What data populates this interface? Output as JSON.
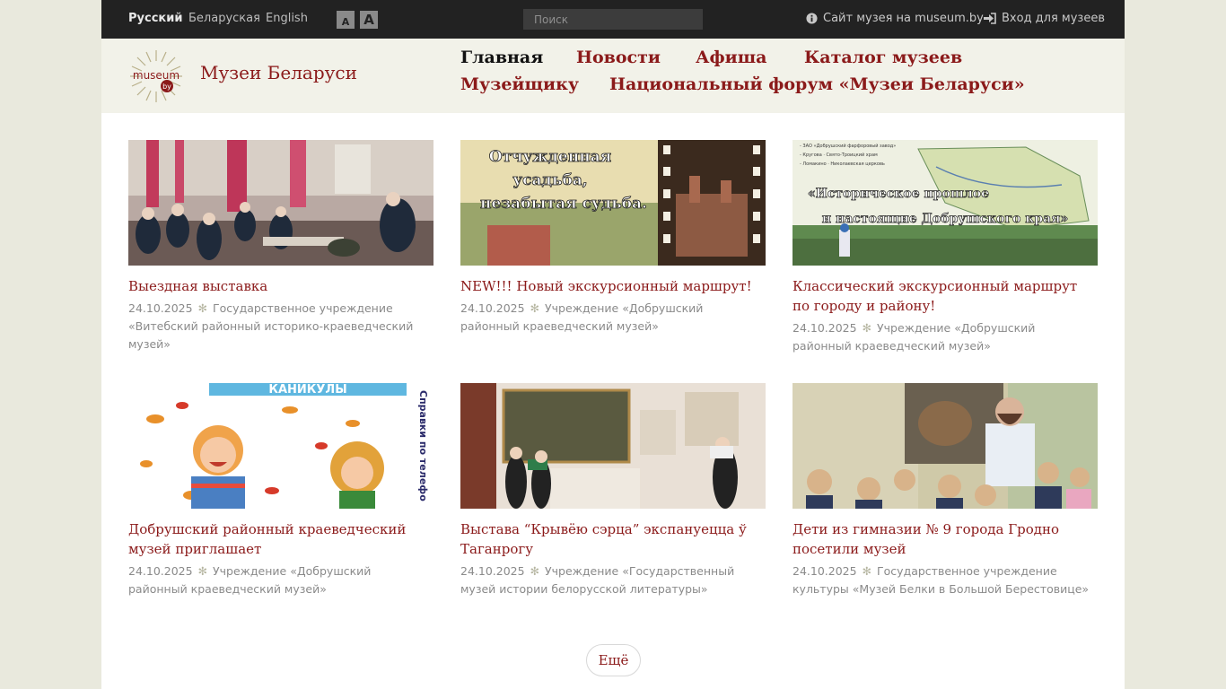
{
  "topbar": {
    "languages": [
      "Русский",
      "Беларуская",
      "English"
    ],
    "font_small": "A",
    "font_large": "A",
    "search_placeholder": "Поиск",
    "museum_site_link": "Сайт музея на museum.by",
    "login_link": "Вход для музеев"
  },
  "header": {
    "logo_text": "museum",
    "logo_badge": "by",
    "site_title": "Музеи Беларуси",
    "nav": [
      "Главная",
      "Новости",
      "Афиша",
      "Каталог музеев",
      "Музейщику",
      "Национальный форум «Музеи Беларуси»"
    ]
  },
  "cards": [
    {
      "title": "Выездная выставка",
      "date": "24.10.2025",
      "source": "Государственное учреждение «Витебский районный историко-краеведческий музей»",
      "image": "classroom-photo"
    },
    {
      "title": "NEW!!! Новый экскурсионный маршрут!",
      "date": "24.10.2025",
      "source": "Учреждение «Добрушский районный краеведческий музей»",
      "image": "estate-banner",
      "image_text": [
        "Отчужденная",
        "усадьба,",
        "незабытая судьба."
      ]
    },
    {
      "title": "Классический экскурсионный маршрут по городу и району!",
      "date": "24.10.2025",
      "source": "Учреждение «Добрушский районный краеведческий музей»",
      "image": "map-banner",
      "image_text": [
        "«Историческое прошлое",
        "и настоящие Добрушского края»"
      ]
    },
    {
      "title": "Добрушский районный краеведческий музей приглашает",
      "date": "24.10.2025",
      "source": "Учреждение «Добрушский районный краеведческий музей»",
      "image": "autumn-holiday-poster",
      "image_text": [
        "КАНИКУЛЫ",
        "Справки по телефо"
      ]
    },
    {
      "title": "Выстава “Крывёю сэрца” экспануецца ў Таганрогу",
      "date": "24.10.2025",
      "source": "Учреждение «Государственный музей истории белорусской литературы»",
      "image": "exhibition-hall-photo"
    },
    {
      "title": "Дети из гимназии № 9 города Гродно посетили музей",
      "date": "24.10.2025",
      "source": "Государственное учреждение культуры «Музей Белки в Большой Берестовице»",
      "image": "children-museum-photo"
    }
  ],
  "more_button": "Ещё",
  "colors": {
    "accent": "#8b1a1a",
    "topbar_bg": "#222222",
    "header_bg": "#f2f2e9",
    "page_bg": "#e9e9dd"
  }
}
